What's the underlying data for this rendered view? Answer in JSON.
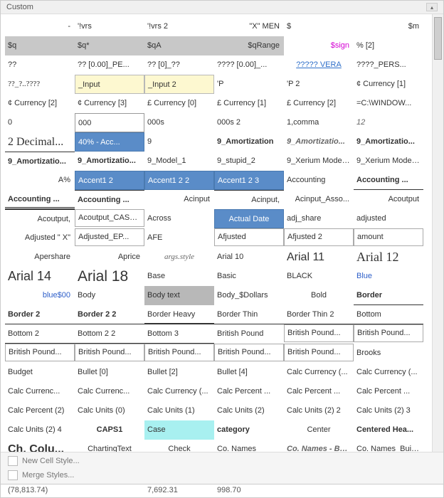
{
  "header": {
    "title": "Custom"
  },
  "footer": {
    "new_style": "New Cell Style...",
    "merge": "Merge Styles..."
  },
  "below": {
    "c0": "(78,813.74)",
    "c2": "7,692.31",
    "c3": "998.70"
  },
  "rows": [
    [
      {
        "t": " - ",
        "cls": "right"
      },
      {
        "t": "'!vrs"
      },
      {
        "t": "'!vrs 2"
      },
      {
        "t": "\"X\" MEN",
        "cls": "right"
      },
      {
        "t": "$"
      },
      {
        "t": "$m",
        "cls": "right"
      }
    ],
    [
      {
        "t": "$q",
        "cls": "hdr-gray"
      },
      {
        "t": "$q*",
        "cls": "hdr-gray"
      },
      {
        "t": "$qA",
        "cls": "hdr-gray"
      },
      {
        "t": "$qRange",
        "cls": "hdr-gray right"
      },
      {
        "t": "$sign",
        "cls": "hdr-magenta"
      },
      {
        "t": "% [2]"
      }
    ],
    [
      {
        "t": "??"
      },
      {
        "t": "?? [0.00]_PE..."
      },
      {
        "t": "?? [0]_??"
      },
      {
        "t": "???? [0.00]_..."
      },
      {
        "t": "?????  VERA",
        "cls": "hdr-link"
      },
      {
        "t": "????_PERS..."
      }
    ],
    [
      {
        "t": "??_?..????",
        "cls": "serif"
      },
      {
        "t": "_Input",
        "cls": "input-yellow"
      },
      {
        "t": "_Input 2",
        "cls": "input-yellow"
      },
      {
        "t": "'P"
      },
      {
        "t": "'P 2"
      },
      {
        "t": "¢ Currency [1]"
      }
    ],
    [
      {
        "t": "¢ Currency [2]"
      },
      {
        "t": "¢ Currency [3]"
      },
      {
        "t": "£ Currency [0]"
      },
      {
        "t": "£ Currency [1]"
      },
      {
        "t": "£ Currency [2]"
      },
      {
        "t": "=C:\\WINDOW..."
      }
    ],
    [
      {
        "t": "0"
      },
      {
        "t": "000",
        "cls": "box-border"
      },
      {
        "t": "000s"
      },
      {
        "t": "000s 2"
      },
      {
        "t": "1,comma"
      },
      {
        "t": "12",
        "cls": "italic"
      }
    ],
    [
      {
        "t": "2 Decimal...",
        "cls": "serif big"
      },
      {
        "t": "40% - Acc...",
        "cls": "blue-sel"
      },
      {
        "t": "9"
      },
      {
        "t": "9_Amortization",
        "cls": "bold"
      },
      {
        "t": "9_Amortizatio...",
        "cls": "bold italic"
      },
      {
        "t": "9_Amortizatio...",
        "cls": "bold"
      }
    ],
    [
      {
        "t": "9_Amortizatio...",
        "cls": "bold ul-top"
      },
      {
        "t": "9_Amortizatio...",
        "cls": "bold"
      },
      {
        "t": "9_Model_1"
      },
      {
        "t": "9_stupid_2"
      },
      {
        "t": "9_Xerium Model ..."
      },
      {
        "t": "9_Xerium Model ..."
      }
    ],
    [
      {
        "t": "A%",
        "cls": "right"
      },
      {
        "t": "Accent1 2",
        "cls": "blue-sel"
      },
      {
        "t": "Accent1 2 2",
        "cls": "blue-sel"
      },
      {
        "t": "Accent1 2 3",
        "cls": "blue-sel"
      },
      {
        "t": "Accounting"
      },
      {
        "t": "Accounting ...",
        "cls": "bold ul-bot"
      }
    ],
    [
      {
        "t": "Accounting ...",
        "cls": "bold ul-dbl-bot"
      },
      {
        "t": "Accounting ...",
        "cls": "bold ul-top"
      },
      {
        "t": "Acinput",
        "cls": "right"
      },
      {
        "t": "Acinput,",
        "cls": "right ul-top"
      },
      {
        "t": "Acinput_Asso...",
        "cls": "right"
      },
      {
        "t": "Acoutput",
        "cls": "right"
      }
    ],
    [
      {
        "t": "Acoutput,",
        "cls": "right ul-top"
      },
      {
        "t": "Acoutput_CASco...",
        "cls": "thin-box"
      },
      {
        "t": "Across"
      },
      {
        "t": "Actual Date",
        "cls": "blue-sel center"
      },
      {
        "t": "adj_share"
      },
      {
        "t": "adjusted"
      }
    ],
    [
      {
        "t": "Adjusted \" X\"",
        "cls": "right"
      },
      {
        "t": "Adjusted_EP...",
        "cls": "thin-box"
      },
      {
        "t": "AFE"
      },
      {
        "t": "Afjusted",
        "cls": "thin-box"
      },
      {
        "t": "Afjusted 2",
        "cls": "thin-box"
      },
      {
        "t": "amount",
        "cls": "thin-box"
      }
    ],
    [
      {
        "t": "Apershare",
        "cls": "right"
      },
      {
        "t": "Aprice",
        "cls": "right"
      },
      {
        "t": "args.style",
        "cls": "serif italic center"
      },
      {
        "t": "Arial 10"
      },
      {
        "t": "Arial 11",
        "cls": "big"
      },
      {
        "t": "Arial 12",
        "cls": "bigger serif"
      }
    ],
    [
      {
        "t": "Arial 14",
        "cls": "bigger"
      },
      {
        "t": "Arial 18",
        "cls": "biggest"
      },
      {
        "t": "Base"
      },
      {
        "t": "Basic"
      },
      {
        "t": "BLACK"
      },
      {
        "t": "Blue",
        "cls": "blue-text"
      }
    ],
    [
      {
        "t": "blue$00",
        "cls": "blue-text right"
      },
      {
        "t": "Body",
        "cls": ""
      },
      {
        "t": "Body text",
        "cls": "gray-sel"
      },
      {
        "t": "Body_$Dollars"
      },
      {
        "t": "Bold",
        "cls": "center"
      },
      {
        "t": "Border",
        "cls": "bold ul-bot"
      }
    ],
    [
      {
        "t": "Border 2",
        "cls": "bold ul-bot"
      },
      {
        "t": "Border 2 2",
        "cls": "bold ul-bot"
      },
      {
        "t": "Border Heavy",
        "cls": "ul-heavy-bot"
      },
      {
        "t": "Border Thin",
        "cls": "ul-bot"
      },
      {
        "t": "Border Thin 2",
        "cls": "ul-bot"
      },
      {
        "t": "Bottom",
        "cls": "ul-bot"
      }
    ],
    [
      {
        "t": "Bottom 2",
        "cls": "ul-bot"
      },
      {
        "t": "Bottom 2 2",
        "cls": "ul-bot"
      },
      {
        "t": "Bottom 3",
        "cls": "ul-bot"
      },
      {
        "t": "British Pound"
      },
      {
        "t": "British Pound...",
        "cls": "thin-box"
      },
      {
        "t": "British Pound...",
        "cls": "thin-box"
      }
    ],
    [
      {
        "t": "British Pound...",
        "cls": "thin-box"
      },
      {
        "t": "British Pound...",
        "cls": "thin-box"
      },
      {
        "t": "British Pound...",
        "cls": "thin-box"
      },
      {
        "t": "British Pound...",
        "cls": "thin-box"
      },
      {
        "t": "British Pound...",
        "cls": "thin-box"
      },
      {
        "t": "Brooks"
      }
    ],
    [
      {
        "t": "Budget"
      },
      {
        "t": "Bullet [0]"
      },
      {
        "t": "Bullet [2]"
      },
      {
        "t": "Bullet [4]"
      },
      {
        "t": "Calc Currency (..."
      },
      {
        "t": "Calc Currency (..."
      }
    ],
    [
      {
        "t": "Calc Currenc..."
      },
      {
        "t": "Calc Currenc..."
      },
      {
        "t": "Calc Currency (..."
      },
      {
        "t": "Calc Percent ..."
      },
      {
        "t": "Calc Percent ..."
      },
      {
        "t": "Calc Percent ..."
      }
    ],
    [
      {
        "t": "Calc Percent (2)"
      },
      {
        "t": "Calc Units (0)"
      },
      {
        "t": "Calc Units (1)"
      },
      {
        "t": "Calc Units (2)"
      },
      {
        "t": "Calc Units (2) 2"
      },
      {
        "t": "Calc Units (2) 3"
      }
    ],
    [
      {
        "t": "Calc Units (2) 4"
      },
      {
        "t": "CAPS1",
        "cls": "bold center"
      },
      {
        "t": "Case",
        "cls": "cyan"
      },
      {
        "t": "category",
        "cls": "bold"
      },
      {
        "t": "Center",
        "cls": "center"
      },
      {
        "t": "Centered Hea...",
        "cls": "bold"
      }
    ],
    [
      {
        "t": "Ch, Colu...",
        "cls": "bold big"
      },
      {
        "t": "ChartingText",
        "cls": "center"
      },
      {
        "t": "Check",
        "cls": "center"
      },
      {
        "t": "Co. Names"
      },
      {
        "t": "Co. Names - Bo...",
        "cls": "bold italic"
      },
      {
        "t": "Co. Names_Buildup..."
      }
    ]
  ]
}
